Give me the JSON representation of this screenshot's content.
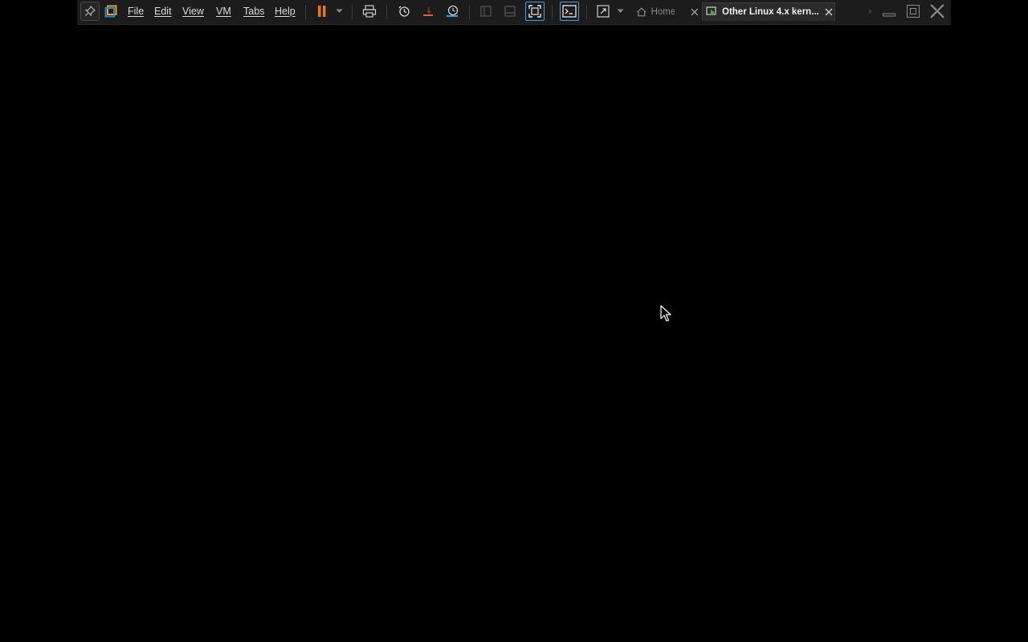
{
  "menu": {
    "file": "File",
    "edit": "Edit",
    "view": "View",
    "vm": "VM",
    "tabs": "Tabs",
    "help": "Help"
  },
  "tabs": [
    {
      "label": "Home",
      "active": false,
      "icon": "home-icon"
    },
    {
      "label": "Other Linux 4.x kern...",
      "active": true,
      "icon": "vm-icon"
    }
  ],
  "toolbar": {
    "icons": [
      "pin-icon",
      "vmware-logo-icon",
      "pause-icon",
      "dropdown-arrow-icon",
      "send-ctrl-alt-del-icon",
      "snapshot-icon",
      "revert-snapshot-icon",
      "snapshot-manager-icon",
      "show-library-icon",
      "show-thumbnail-bar-icon",
      "full-screen-icon",
      "console-view-icon",
      "stretch-guest-icon",
      "stretch-dropdown-icon",
      "scroll-arrow-icon"
    ]
  },
  "window_controls": [
    "minimize-icon",
    "restore-icon",
    "close-icon"
  ],
  "colors": {
    "toolbar_bg": "#1c1c1c",
    "screen_bg": "#000000",
    "pause_accent": "#e8761e",
    "vmware_logo_orange": "#f29a1e",
    "vmware_logo_blue": "#1d8dd9",
    "active_icon_border": "#4a9fe0"
  }
}
